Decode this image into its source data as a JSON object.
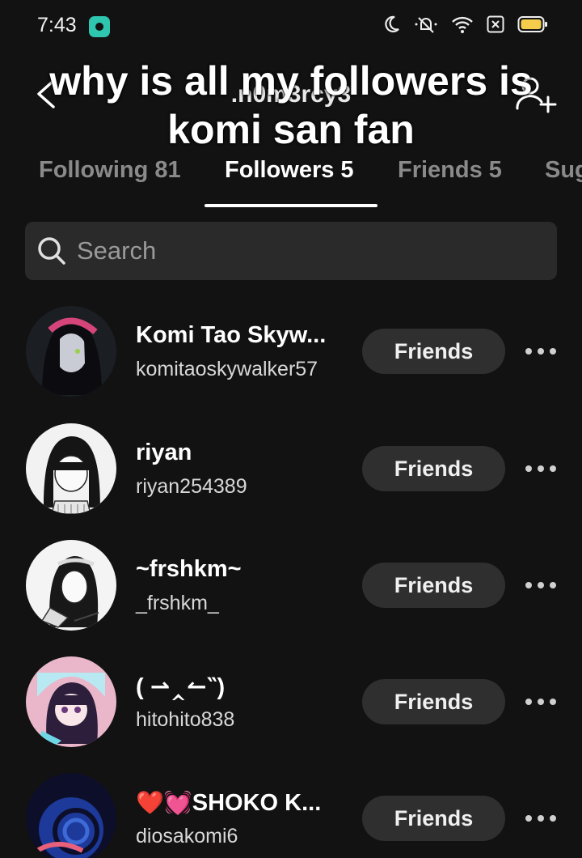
{
  "status_bar": {
    "time": "7:43",
    "icons": [
      "app-notification-icon",
      "moon-icon",
      "mute-icon",
      "wifi-icon",
      "close-box-icon",
      "battery-icon"
    ]
  },
  "header": {
    "username": ".n0m3rcy3",
    "back_icon": "arrow-left-icon",
    "add_icon": "add-friend-icon"
  },
  "overlay_caption": "why is all my followers is komi san fan",
  "tabs": [
    {
      "label": "Following 81",
      "active": false
    },
    {
      "label": "Followers 5",
      "active": true
    },
    {
      "label": "Friends 5",
      "active": false
    },
    {
      "label": "Sug",
      "active": false
    }
  ],
  "search": {
    "placeholder": "Search",
    "value": ""
  },
  "followers": [
    {
      "name": "Komi Tao Skyw...",
      "handle": "komitaoskywalker57",
      "button": "Friends"
    },
    {
      "name": "riyan",
      "handle": "riyan254389",
      "button": "Friends"
    },
    {
      "name": "~frshkm~",
      "handle": "_frshkm_",
      "button": "Friends"
    },
    {
      "name": "( ⇀‸↼‶)",
      "handle": "hitohito838",
      "button": "Friends"
    },
    {
      "name_emoji": "❤️💓",
      "name": "SHOKO K...",
      "handle": "diosakomi6",
      "button": "Friends"
    }
  ],
  "colors": {
    "background": "#121212",
    "search_bg": "#2a2a2a",
    "button_bg": "#2f2f2f",
    "inactive_tab": "#8a8a8a"
  }
}
